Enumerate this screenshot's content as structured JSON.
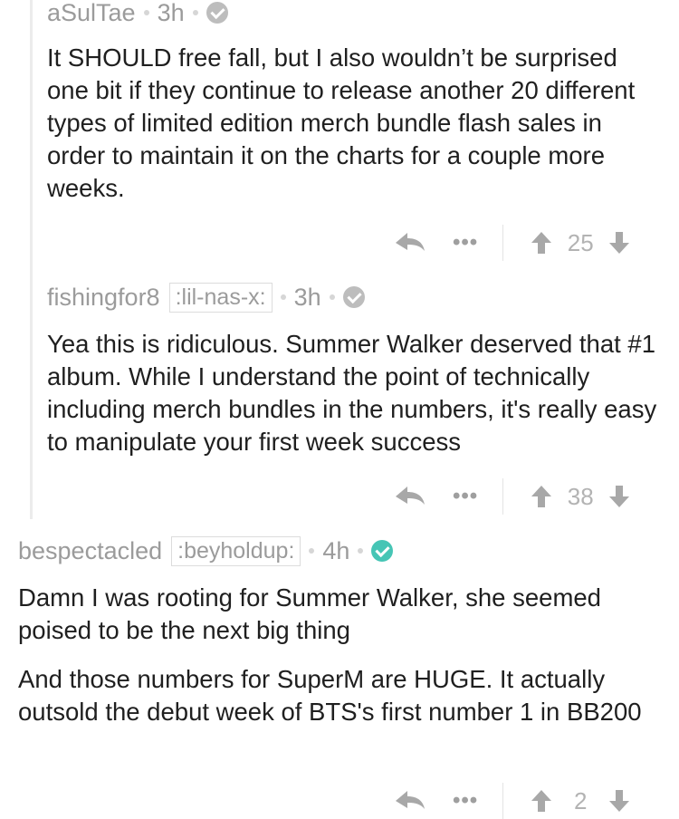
{
  "comments": [
    {
      "username": "aSulTae",
      "flair": "",
      "time": "3h",
      "verified_style": "grey",
      "paragraphs": [
        "It SHOULD free fall, but I also wouldn’t be surprised one bit if they continue to release another 20 different types of limited edition merch bundle flash sales in order to maintain it on the charts for a couple more weeks."
      ],
      "score": "25"
    },
    {
      "username": "fishingfor8",
      "flair": ":lil-nas-x:",
      "time": "3h",
      "verified_style": "grey",
      "paragraphs": [
        "Yea this is ridiculous. Summer Walker deserved that #1 album. While I understand the point of technically including merch bundles in the numbers, it's really easy to manipulate your first week success"
      ],
      "score": "38"
    },
    {
      "username": "bespectacled",
      "flair": ":beyholdup:",
      "time": "4h",
      "verified_style": "teal",
      "paragraphs": [
        "Damn I was rooting for Summer Walker, she seemed poised to be the next big thing",
        "And those numbers for SuperM are HUGE. It actually outsold the debut week of BTS's first number 1 in BB200"
      ],
      "score": "2"
    }
  ],
  "icons": {
    "reply": "reply-icon",
    "more": "more-icon",
    "upvote": "upvote-icon",
    "downvote": "downvote-icon",
    "verified": "check-circle-icon"
  },
  "colors": {
    "meta_grey": "#9b9b9b",
    "verified_teal": "#46c5b5",
    "thread_line": "#ececec"
  }
}
